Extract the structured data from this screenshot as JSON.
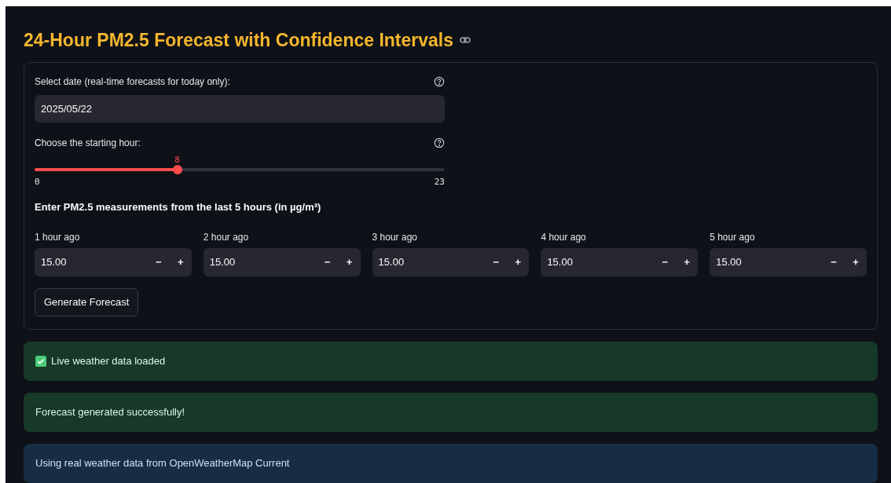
{
  "title": "24-Hour PM2.5 Forecast with Confidence Intervals",
  "form": {
    "date": {
      "label": "Select date (real-time forecasts for today only):",
      "value": "2025/05/22"
    },
    "hour": {
      "label": "Choose the starting hour:",
      "value": "8",
      "min": "0",
      "max": "23",
      "level": 0.348
    },
    "measurements_heading": "Enter PM2.5 measurements from the last 5 hours (in µg/m³)",
    "measurements": [
      {
        "label": "1 hour ago",
        "value": "15.00"
      },
      {
        "label": "2 hour ago",
        "value": "15.00"
      },
      {
        "label": "3 hour ago",
        "value": "15.00"
      },
      {
        "label": "4 hour ago",
        "value": "15.00"
      },
      {
        "label": "5 hour ago",
        "value": "15.00"
      }
    ],
    "minus": "−",
    "plus": "+",
    "submit": "Generate Forecast"
  },
  "alerts": [
    {
      "kind": "success",
      "checked": true,
      "text": "Live weather data loaded"
    },
    {
      "kind": "success",
      "checked": false,
      "text": "Forecast generated successfully!"
    },
    {
      "kind": "info",
      "checked": false,
      "text": "Using real weather data from OpenWeatherMap Current"
    }
  ]
}
